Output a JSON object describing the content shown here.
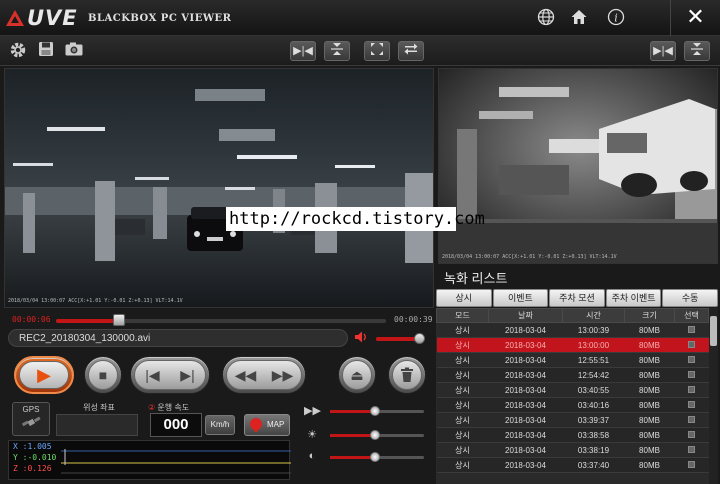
{
  "app": {
    "logo_text": "UVE",
    "title": "BLACKBOX PC VIEWER",
    "close_glyph": "✕",
    "icons": [
      "globe-icon",
      "home-icon",
      "info-icon"
    ]
  },
  "video": {
    "front_osd": "2018/03/04 13:00:07 ACC[X:+1.01 Y:-0.01 Z:+0.13] VLT:14.1V",
    "rear_osd": "2018/03/04 13:00:07 ACC[X:+1.01 Y:-0.01 Z:+0.13] VLT:14.1V",
    "watermark": "http://rockcd.tistory.com"
  },
  "playback": {
    "current_time": "00:00:06",
    "total_time": "00:00:39",
    "progress": 0.19,
    "file_name": "REC2_20180304_130000.avi",
    "volume": 0.95
  },
  "info": {
    "gps_label": "GPS",
    "coord_label": "위성 좌표",
    "speed_label_num": "②",
    "speed_label_text": "운행 속도",
    "speed_value": "000",
    "speed_unit": "Km/h",
    "map_label": "MAP",
    "g_x": "X :1.005",
    "g_y": "Y :-0.010",
    "g_z": "Z :0.126"
  },
  "sliders": {
    "speed": 0.48,
    "brightness": 0.48,
    "contrast": 0.48
  },
  "list": {
    "title": "녹화 리스트",
    "filters": [
      "상시",
      "이벤트",
      "주차 모션",
      "주차 이벤트",
      "수동"
    ],
    "columns": [
      "모드",
      "날짜",
      "시간",
      "크기",
      "선택"
    ],
    "rows": [
      {
        "mode": "상시",
        "date": "2018-03-04",
        "time": "13:00:39",
        "size": "80MB",
        "selected": false
      },
      {
        "mode": "상시",
        "date": "2018-03-04",
        "time": "13:00:00",
        "size": "80MB",
        "selected": true
      },
      {
        "mode": "상시",
        "date": "2018-03-04",
        "time": "12:55:51",
        "size": "80MB",
        "selected": false
      },
      {
        "mode": "상시",
        "date": "2018-03-04",
        "time": "12:54:42",
        "size": "80MB",
        "selected": false
      },
      {
        "mode": "상시",
        "date": "2018-03-04",
        "time": "03:40:55",
        "size": "80MB",
        "selected": false
      },
      {
        "mode": "상시",
        "date": "2018-03-04",
        "time": "03:40:16",
        "size": "80MB",
        "selected": false
      },
      {
        "mode": "상시",
        "date": "2018-03-04",
        "time": "03:39:37",
        "size": "80MB",
        "selected": false
      },
      {
        "mode": "상시",
        "date": "2018-03-04",
        "time": "03:38:58",
        "size": "80MB",
        "selected": false
      },
      {
        "mode": "상시",
        "date": "2018-03-04",
        "time": "03:38:19",
        "size": "80MB",
        "selected": false
      },
      {
        "mode": "상시",
        "date": "2018-03-04",
        "time": "03:37:40",
        "size": "80MB",
        "selected": false
      }
    ]
  }
}
